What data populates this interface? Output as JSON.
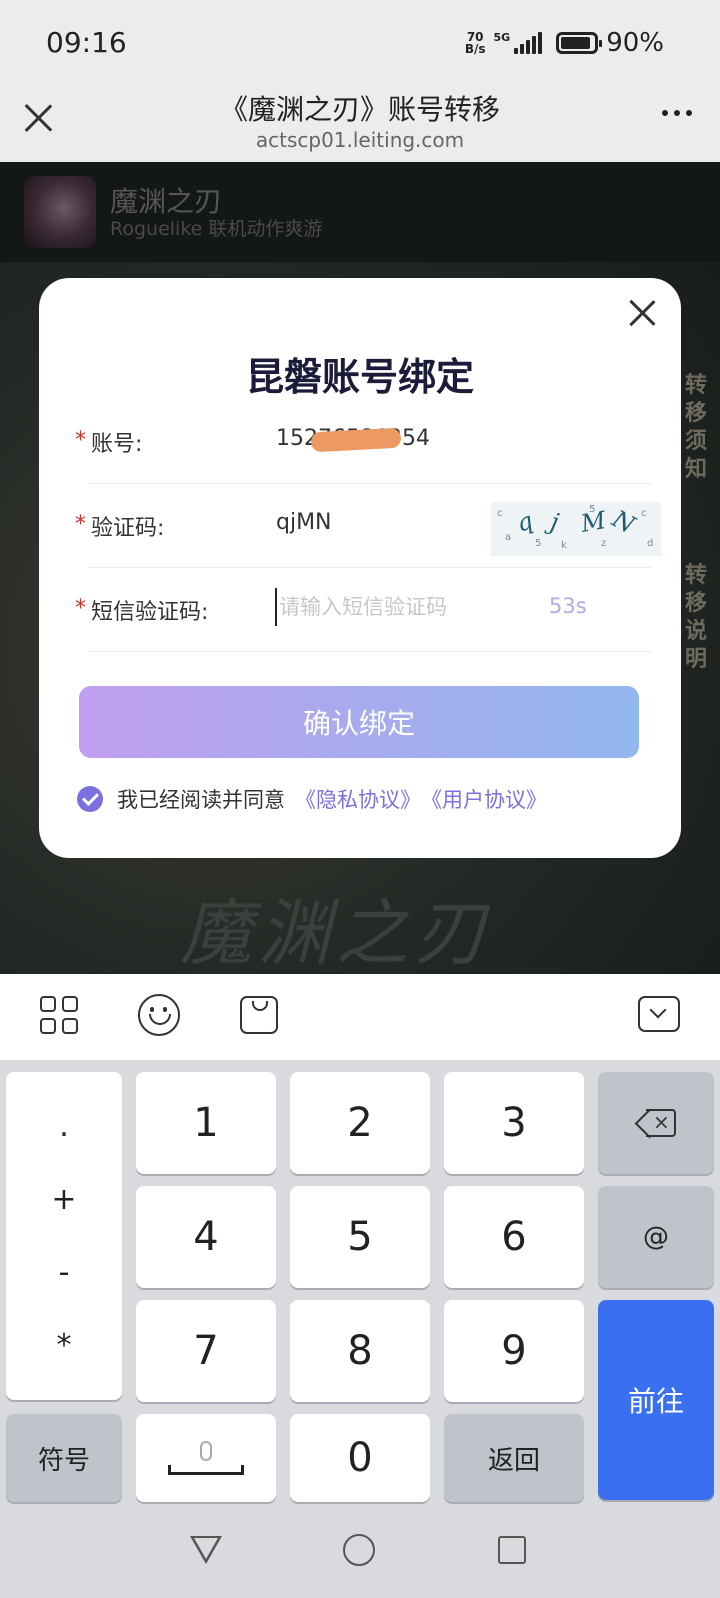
{
  "status_bar": {
    "time": "09:16",
    "net_speed_value": "70",
    "net_speed_unit": "B/s",
    "network": "5G",
    "battery": "90%",
    "battery_level": 0.9
  },
  "title_bar": {
    "title": "《魔渊之刃》账号转移",
    "url": "actscp01.leiting.com",
    "close_icon": "close-icon",
    "more_icon": "more-icon"
  },
  "page": {
    "game_name": "魔渊之刃",
    "game_subtitle": "Roguelike 联机动作爽游",
    "side_tab_1": "转移须知",
    "side_tab_2": "转移说明",
    "bg_title": "魔渊之刃"
  },
  "modal": {
    "title": "昆磐账号绑定",
    "required_mark": "*",
    "account_label": "账号:",
    "account_value": "15276586354",
    "captcha_label": "验证码:",
    "captcha_value": "qjMN",
    "captcha_image_chars": [
      "q",
      "j",
      "M",
      "N"
    ],
    "sms_label": "短信验证码:",
    "sms_placeholder": "请输入短信验证码",
    "countdown": "53s",
    "confirm_button": "确认绑定",
    "agree_text": "我已经阅读并同意",
    "privacy_link": "《隐私协议》",
    "user_link": "《用户协议》",
    "colors": {
      "accent": "#7d6fe1",
      "button_gradient_start": "#c19ef0",
      "button_gradient_end": "#92b7ee",
      "required": "#c8302a"
    }
  },
  "keyboard": {
    "toolbar_icons": [
      "grid-icon",
      "emoji-icon",
      "shop-bag-icon",
      "hide-keyboard-icon"
    ],
    "symbol_column": [
      ".",
      "+",
      "-",
      "*"
    ],
    "digits": [
      "1",
      "2",
      "3",
      "4",
      "5",
      "6",
      "7",
      "8",
      "9",
      "0"
    ],
    "at": "@",
    "symbols_key": "符号",
    "return_key": "返回",
    "go_key": "前往",
    "go_color": "#3b6ff2"
  },
  "nav_bar": {
    "icons": [
      "back-triangle-icon",
      "home-circle-icon",
      "recents-square-icon"
    ]
  }
}
